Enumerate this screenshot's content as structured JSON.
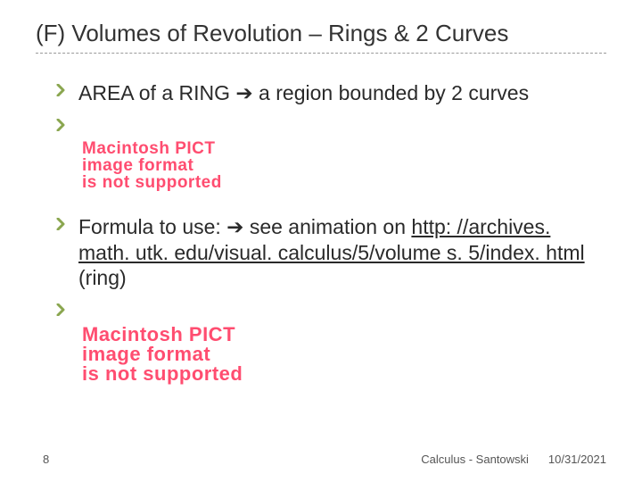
{
  "title": "(F) Volumes of Revolution – Rings & 2 Curves",
  "bullets": {
    "b1": "AREA of a RING ➔ a region bounded by 2 curves",
    "b2_pre": "Formula to use:  ➔  see animation on ",
    "b2_link": "http: //archives. math. utk. edu/visual. calculus/5/volume s. 5/index. html",
    "b2_post": " (ring)"
  },
  "pict": {
    "l1": "Macintosh PICT",
    "l2": "image format",
    "l3": "is not supported"
  },
  "footer": {
    "page": "8",
    "center": "Calculus - Santowski",
    "date": "10/31/2021"
  }
}
